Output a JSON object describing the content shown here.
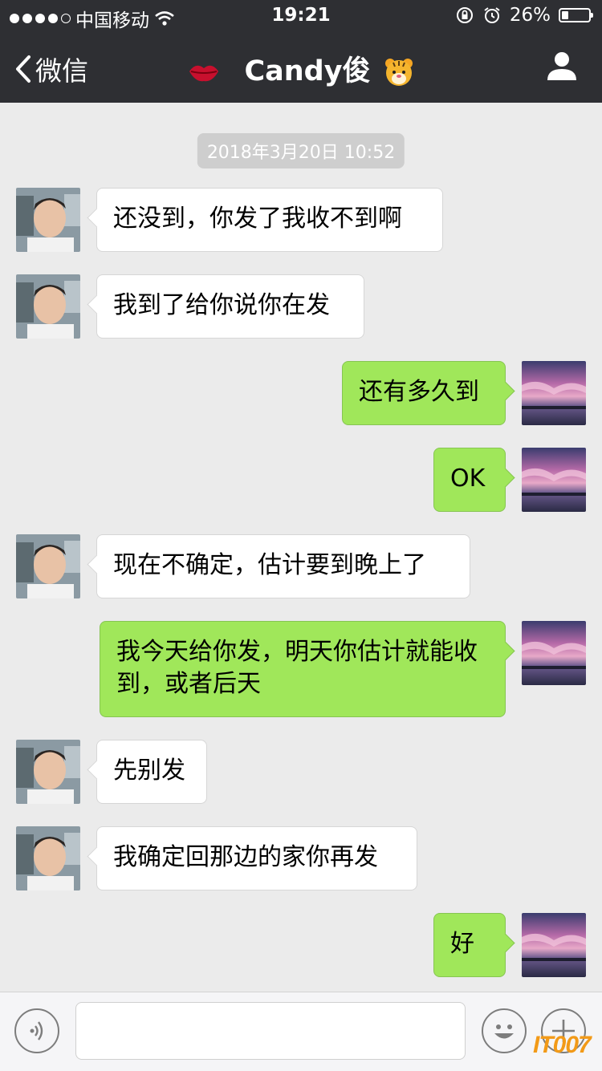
{
  "status_bar": {
    "carrier": "中国移动",
    "time": "19:21",
    "battery": "26%",
    "battery_level": 0.26
  },
  "nav": {
    "back_label": "微信",
    "title": "Candy俊"
  },
  "chat": {
    "timestamp": "2018年3月20日 10:52",
    "messages": [
      {
        "side": "in",
        "text": "还没到，你发了我收不到啊"
      },
      {
        "side": "in",
        "text": "我到了给你说你在发"
      },
      {
        "side": "out",
        "text": "还有多久到"
      },
      {
        "side": "out",
        "text": "OK"
      },
      {
        "side": "in",
        "text": "现在不确定，估计要到晚上了"
      },
      {
        "side": "out",
        "text": " 我今天给你发，明天你估计就能收到，或者后天"
      },
      {
        "side": "in",
        "text": "先别发"
      },
      {
        "side": "in",
        "text": "我确定回那边的家你再发"
      },
      {
        "side": "out",
        "text": "好"
      }
    ]
  },
  "input": {
    "value": ""
  },
  "watermark": "IT007",
  "icons": {
    "back": "chevron-left-icon",
    "profile": "person-icon",
    "voice": "voice-icon",
    "emoji": "emoji-icon",
    "more": "plus-icon",
    "title_left": "kiss-lips-emoji",
    "title_right": "tiger-face-emoji"
  },
  "colors": {
    "nav_bg": "#2e2f33",
    "chat_bg": "#ebebeb",
    "outgoing_bubble": "#a0e75a",
    "incoming_bubble": "#ffffff",
    "timestamp_bg": "#cecece"
  }
}
